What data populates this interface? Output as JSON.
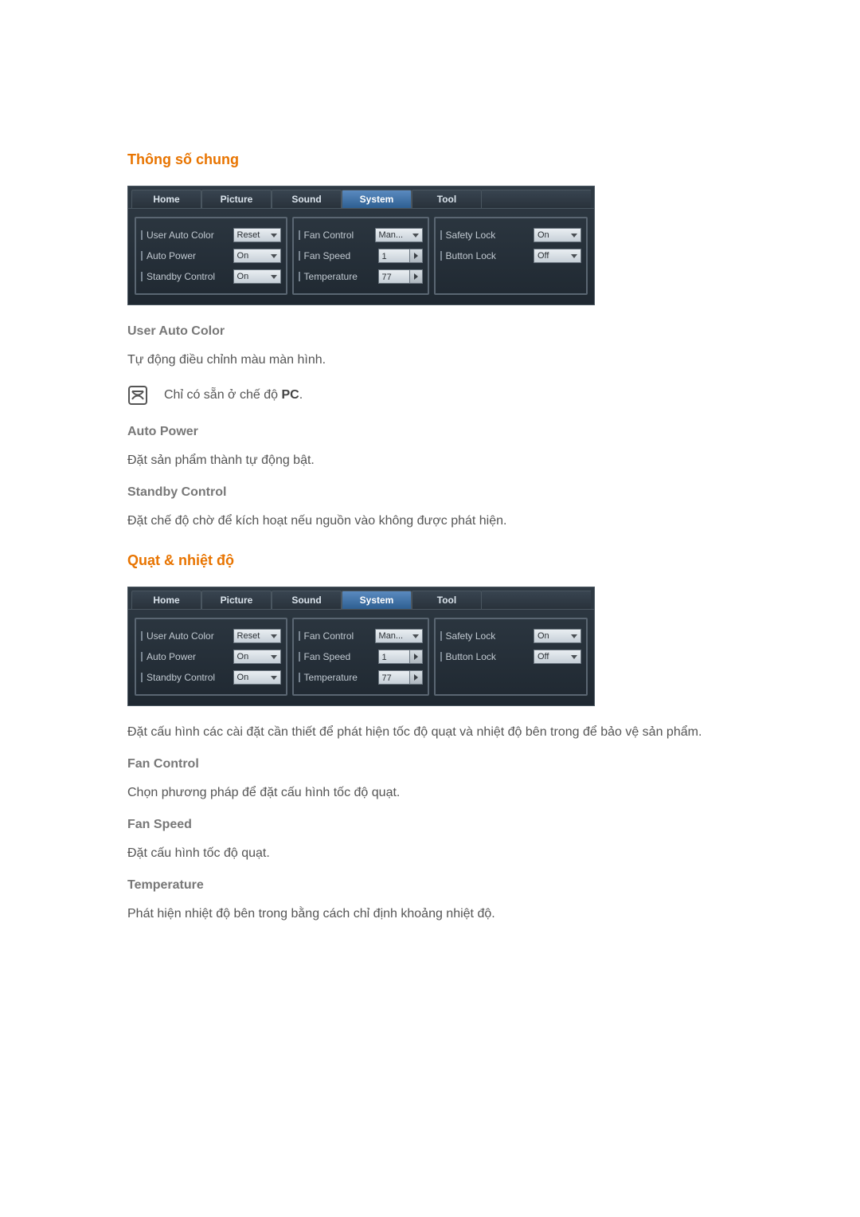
{
  "sections": {
    "general": {
      "title": "Thông số chung",
      "items": {
        "user_auto_color": {
          "heading": "User Auto Color",
          "desc": "Tự động điều chỉnh màu màn hình.",
          "note_prefix": "Chỉ có sẵn ở chế độ ",
          "note_bold": "PC",
          "note_suffix": "."
        },
        "auto_power": {
          "heading": "Auto Power",
          "desc": "Đặt sản phẩm thành tự động bật."
        },
        "standby_control": {
          "heading": "Standby Control",
          "desc": "Đặt chế độ chờ để kích hoạt nếu nguồn vào không được phát hiện."
        }
      }
    },
    "fan_temp": {
      "title": "Quạt & nhiệt độ",
      "intro": "Đặt cấu hình các cài đặt cần thiết để phát hiện tốc độ quạt và nhiệt độ bên trong để bảo vệ sản phẩm.",
      "items": {
        "fan_control": {
          "heading": "Fan Control",
          "desc": "Chọn phương pháp để đặt cấu hình tốc độ quạt."
        },
        "fan_speed": {
          "heading": "Fan Speed",
          "desc": "Đặt cấu hình tốc độ quạt."
        },
        "temperature": {
          "heading": "Temperature",
          "desc": "Phát hiện nhiệt độ bên trong bằng cách chỉ định khoảng nhiệt độ."
        }
      }
    }
  },
  "panel": {
    "tabs": {
      "home": "Home",
      "picture": "Picture",
      "sound": "Sound",
      "system": "System",
      "tool": "Tool"
    },
    "col_a": {
      "user_auto_color": {
        "label": "User Auto Color",
        "value": "Reset"
      },
      "auto_power": {
        "label": "Auto Power",
        "value": "On"
      },
      "standby_control": {
        "label": "Standby Control",
        "value": "On"
      }
    },
    "col_b": {
      "fan_control": {
        "label": "Fan Control",
        "value": "Man..."
      },
      "fan_speed": {
        "label": "Fan Speed",
        "value": "1"
      },
      "temperature": {
        "label": "Temperature",
        "value": "77"
      }
    },
    "col_c": {
      "safety_lock": {
        "label": "Safety Lock",
        "value": "On"
      },
      "button_lock": {
        "label": "Button Lock",
        "value": "Off"
      }
    }
  }
}
